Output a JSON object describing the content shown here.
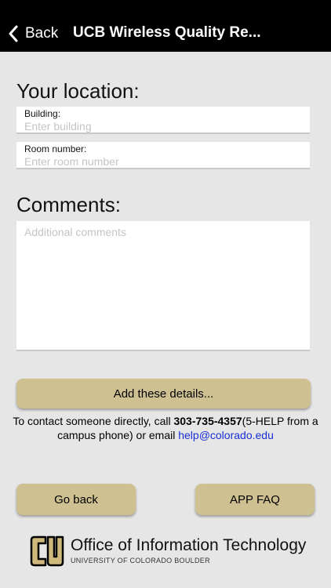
{
  "navbar": {
    "back_label": "Back",
    "title": "UCB Wireless Quality Re..."
  },
  "location": {
    "heading": "Your location:",
    "building_label": "Building:",
    "building_placeholder": "Enter building",
    "building_value": "",
    "room_label": "Room number:",
    "room_placeholder": "Enter room number",
    "room_value": ""
  },
  "comments": {
    "heading": "Comments:",
    "placeholder": "Additional comments",
    "value": ""
  },
  "actions": {
    "add_details_label": "Add these details...",
    "go_back_label": "Go back",
    "faq_label": "APP FAQ"
  },
  "contact": {
    "prefix": "To contact someone directly, call ",
    "phone": "303-735-4357",
    "middle": "(5-HELP from a campus phone) or email ",
    "email": "help@colorado.edu"
  },
  "footer": {
    "org_name": "Office of Information Technology",
    "university": "UNIVERSITY OF COLORADO BOULDER"
  },
  "colors": {
    "navbar": "#000000",
    "background": "#e6e6e6",
    "button_gold": "#cfc092",
    "link": "#1a2fd8"
  }
}
